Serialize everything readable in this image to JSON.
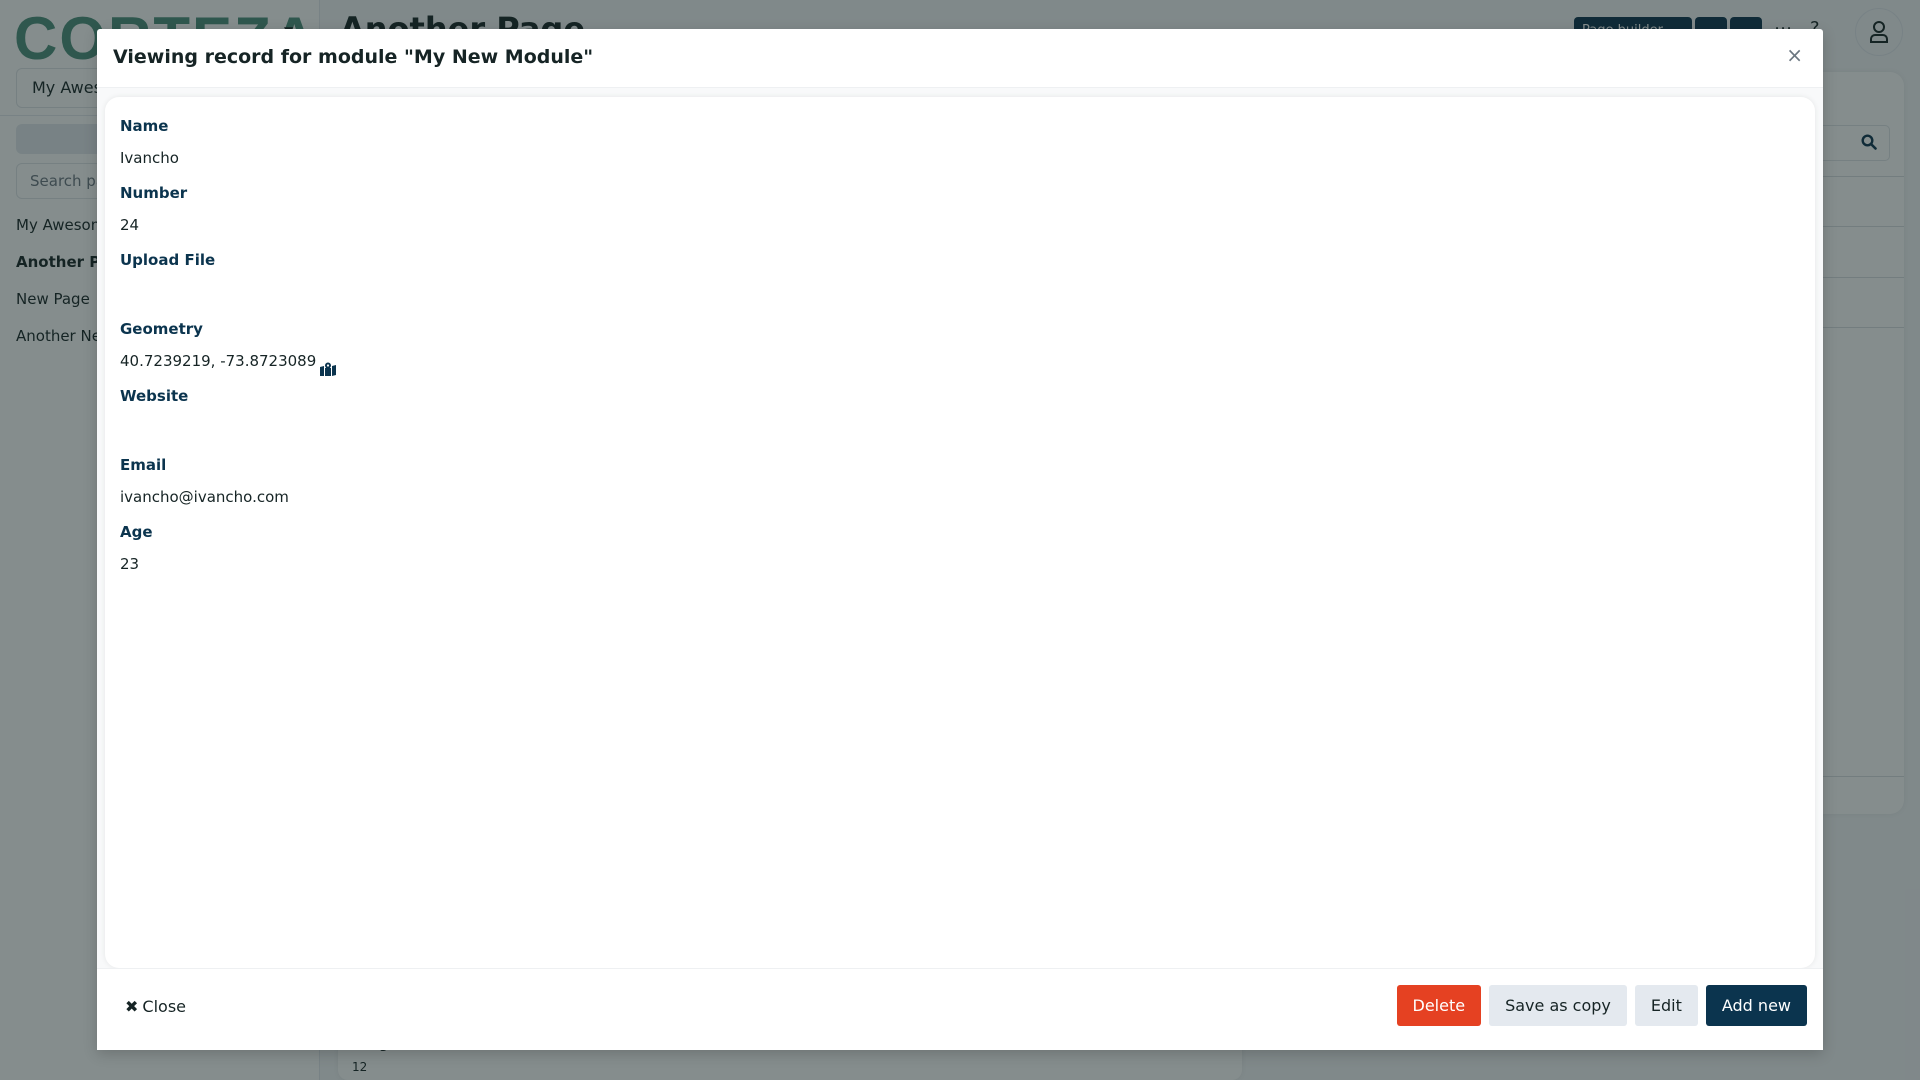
{
  "app": {
    "logo": "CORTEZA",
    "namespace_select": "My Awesome Namespace",
    "page_search_placeholder": "Search pages",
    "pages": [
      {
        "label": "My Awesome Page",
        "active": false
      },
      {
        "label": "Another Page",
        "active": true
      },
      {
        "label": "New Page",
        "active": false
      },
      {
        "label": "Another New Page",
        "active": false
      }
    ],
    "page_title": "Another Page",
    "page_builder_label": "Page builder",
    "background_record": {
      "name": "Dragan",
      "number": "12"
    }
  },
  "modal": {
    "title": "Viewing record for module \"My New Module\"",
    "close_symbol": "×",
    "fields": [
      {
        "label": "Name",
        "value": "Ivancho"
      },
      {
        "label": "Number",
        "value": "24"
      },
      {
        "label": "Upload File",
        "value": ""
      },
      {
        "label": "Geometry",
        "value": "40.7239219, -73.8723089",
        "icon": "map-marked-icon"
      },
      {
        "label": "Website",
        "value": ""
      },
      {
        "label": "Email",
        "value": "ivancho@ivancho.com"
      },
      {
        "label": "Age",
        "value": "23"
      }
    ],
    "footer": {
      "close_label": "Close",
      "close_symbol": "✖",
      "delete_label": "Delete",
      "save_as_copy_label": "Save as copy",
      "edit_label": "Edit",
      "add_new_label": "Add new"
    }
  },
  "colors": {
    "primary": "#0b344e",
    "danger": "#e54122",
    "light": "#e4e9ef",
    "logo": "#4d8f7b"
  }
}
